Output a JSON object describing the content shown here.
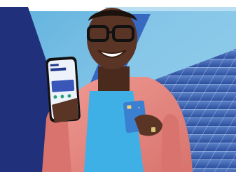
{
  "photo": {
    "colors": {
      "sky": "#7fc4e6",
      "navy_band": "#2b3a8f",
      "solar_panel": "#3e63b5",
      "shirt": "#e98a84",
      "tshirt": "#3fb0e6",
      "skin": "#5a3526",
      "phone_screen": "#eef2fb",
      "card": "#3b7fd0"
    },
    "phone_screen": {
      "title": "",
      "balance": ""
    }
  }
}
